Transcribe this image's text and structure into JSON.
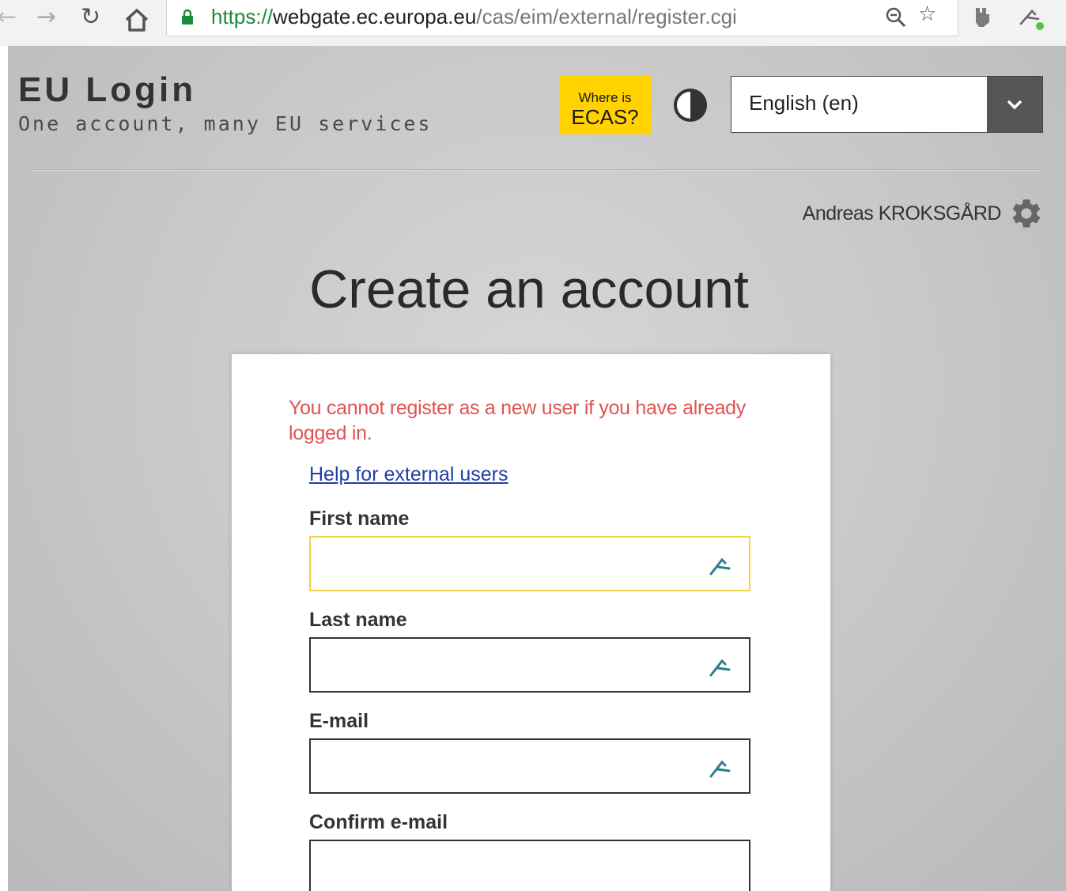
{
  "browser": {
    "url_scheme": "https://",
    "url_host": "webgate.ec.europa.eu",
    "url_path": "/cas/eim/external/register.cgi",
    "nav_icons": [
      "back-icon",
      "forward-icon",
      "reload-icon",
      "home-icon"
    ],
    "address_icons": [
      "lock-icon",
      "zoom-icon",
      "bookmark-star-icon"
    ],
    "extension_icons": [
      "extension-icon",
      "autofill-extension-icon"
    ]
  },
  "header": {
    "title": "EU Login",
    "tagline": "One account, many EU services",
    "ecas_small": "Where is",
    "ecas_big": "ECAS?",
    "contrast_icon": "contrast-icon",
    "language": "English (en)",
    "accent": "#ffd200"
  },
  "user": {
    "name": "Andreas KROKSGÅRD",
    "settings_icon": "gear-icon"
  },
  "main": {
    "title": "Create an account",
    "error": "You cannot register as a new user if you have already logged in.",
    "error_color": "#e05353",
    "help_link": "Help for external users",
    "fields": [
      {
        "label": "First name",
        "value": "",
        "focused": true
      },
      {
        "label": "Last name",
        "value": ""
      },
      {
        "label": "E-mail",
        "value": ""
      },
      {
        "label": "Confirm e-mail",
        "value": ""
      }
    ]
  }
}
